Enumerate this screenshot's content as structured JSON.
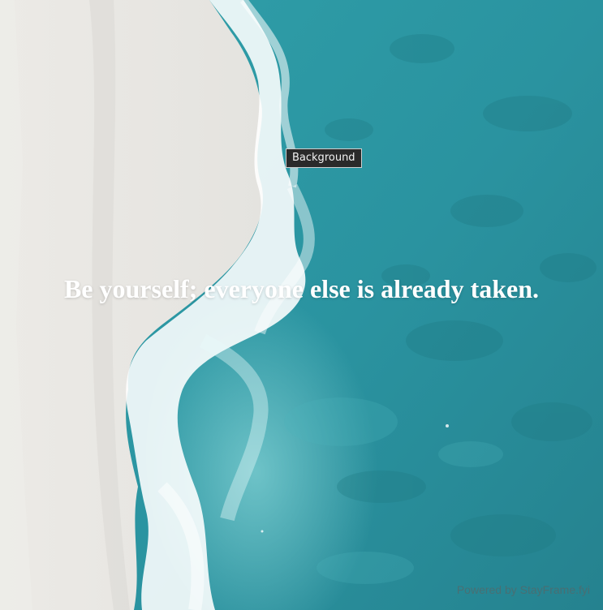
{
  "background": {
    "tooltip": "Background"
  },
  "quote": {
    "text": "Be yourself; everyone else is already taken."
  },
  "footer": {
    "powered_by": "Powered by StayFrame.fyi"
  },
  "colors": {
    "sand": "#e4e3df",
    "ocean": "#2e9aa5",
    "deep_ocean": "#24828d",
    "foam": "#ffffff",
    "text": "#ffffff"
  }
}
